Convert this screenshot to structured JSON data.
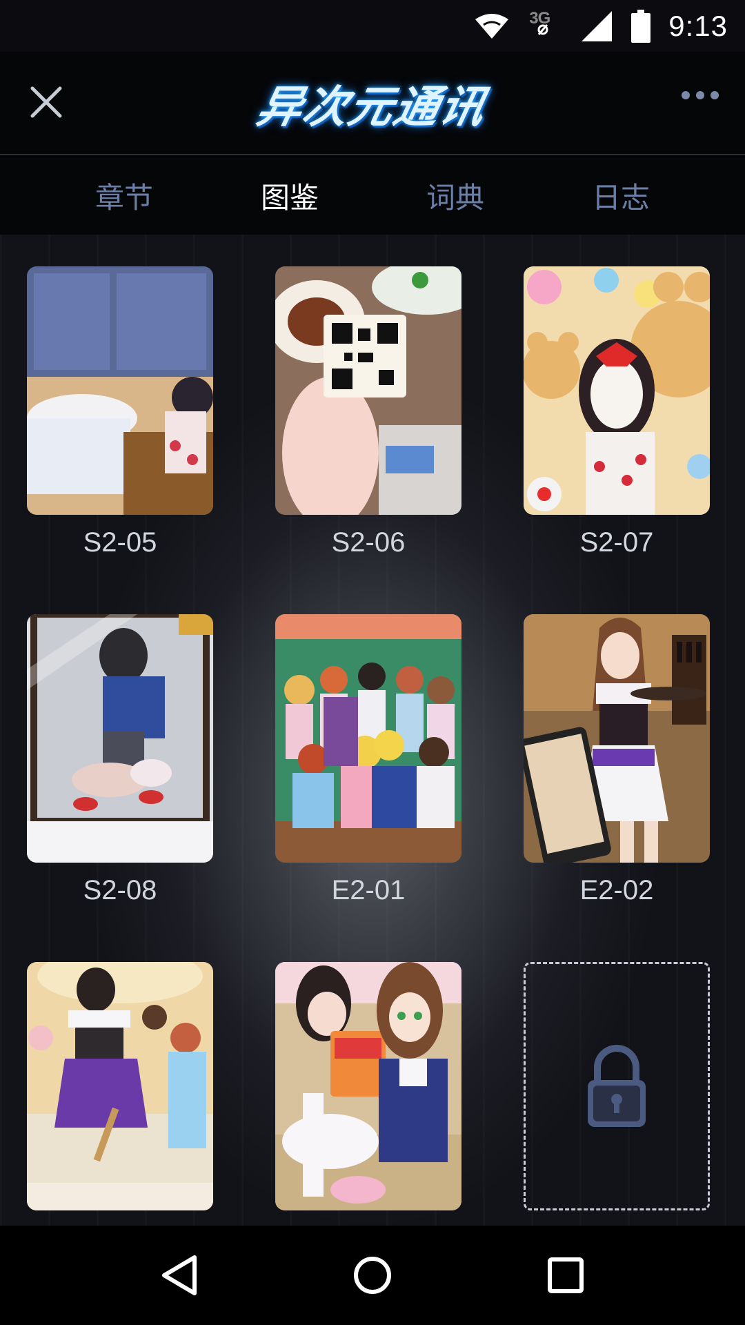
{
  "status_bar": {
    "time": "9:13",
    "network": "3G",
    "icons": [
      "wifi-icon",
      "signal-icon",
      "battery-icon"
    ]
  },
  "header": {
    "logo_text": "异次元通讯",
    "close_icon": "close-icon",
    "more_icon": "more-icon"
  },
  "tabs": [
    {
      "label": "章节",
      "active": false
    },
    {
      "label": "图鉴",
      "active": true
    },
    {
      "label": "词典",
      "active": false
    },
    {
      "label": "日志",
      "active": false
    }
  ],
  "gallery": [
    {
      "label": "S2-05",
      "locked": false
    },
    {
      "label": "S2-06",
      "locked": false
    },
    {
      "label": "S2-07",
      "locked": false
    },
    {
      "label": "S2-08",
      "locked": false
    },
    {
      "label": "E2-01",
      "locked": false
    },
    {
      "label": "E2-02",
      "locked": false
    },
    {
      "label": "",
      "locked": false
    },
    {
      "label": "",
      "locked": false
    },
    {
      "label": "",
      "locked": true
    }
  ],
  "nav_bar": {
    "icons": [
      "back-icon",
      "home-icon",
      "recents-icon"
    ]
  },
  "colors": {
    "tab_inactive": "#6b7ea6",
    "tab_active": "#ffffff",
    "logo_glow": "#2aa6ff"
  }
}
